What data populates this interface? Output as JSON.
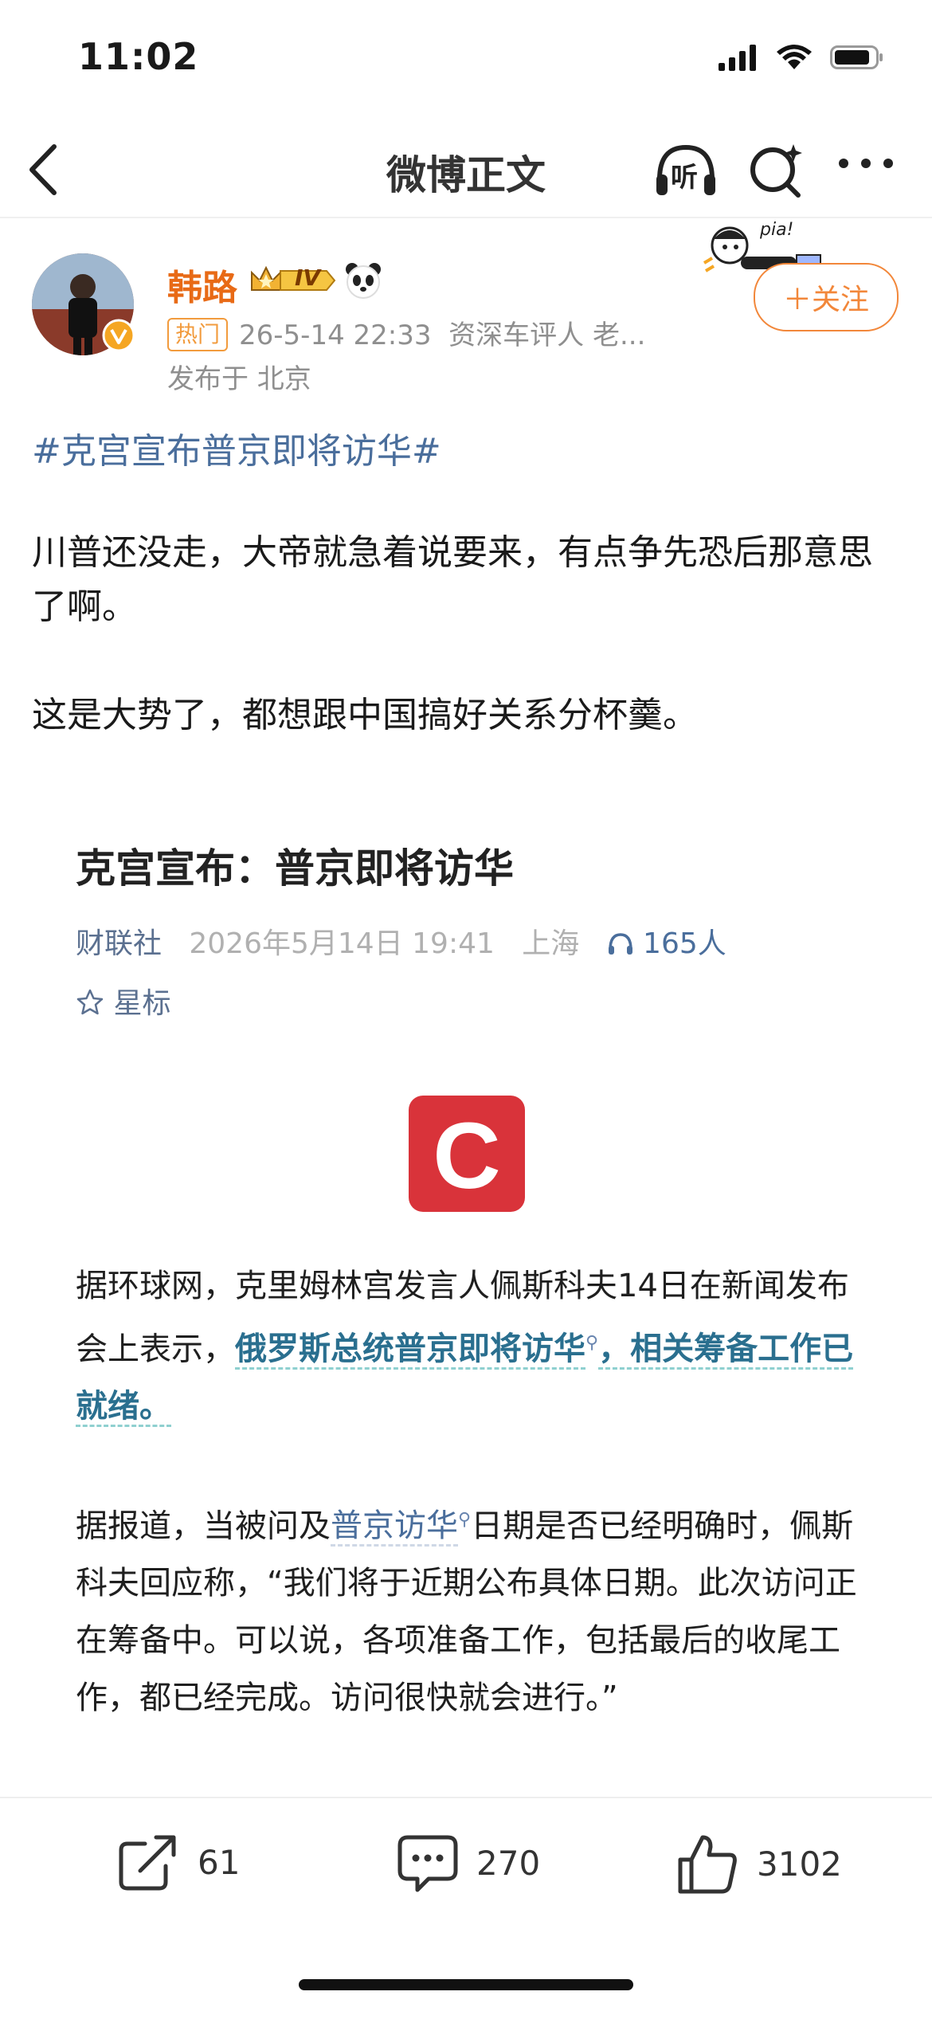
{
  "status_bar": {
    "time": "11:02"
  },
  "nav": {
    "title": "微博正文",
    "listen_label": "听"
  },
  "author": {
    "name": "韩路",
    "level_badge": "IV",
    "hot_badge": "热门",
    "timestamp": "26-5-14 22:33",
    "description": "资深车评人 老...",
    "location": "发布于 北京",
    "follow_label": "＋关注",
    "sticker_text": "pia!"
  },
  "post": {
    "hashtag": "#克宫宣布普京即将访华#",
    "paragraph1": "川普还没走，大帝就急着说要来，有点争先恐后那意思了啊。",
    "paragraph2": "这是大势了，都想跟中国搞好关系分杯羹。"
  },
  "article": {
    "title": "克宫宣布：普京即将访华",
    "source": "财联社",
    "datetime": "2026年5月14日 19:41",
    "place": "上海",
    "listeners": "165人",
    "star_label": "星标",
    "logo_letter": "C",
    "p1_start": "据环球网，克里姆林宫发言人佩斯科夫14日在新闻发布会上表示，",
    "p1_highlight": "俄罗斯总统普京即将访华",
    "p1_end": "，相关筹备工作已就绪。",
    "p2_start": "据报道，当被问及",
    "p2_link": "普京访华",
    "p2_end": "日期是否已经明确时，佩斯科夫回应称，“我们将于近期公布具体日期。此次访问正在筹备中。可以说，各项准备工作，包括最后的收尾工作，都已经完成。访问很快就会进行。”"
  },
  "actions": {
    "repost_count": "61",
    "comment_count": "270",
    "like_count": "3102"
  },
  "colors": {
    "accent_orange": "#f2873a",
    "link_blue": "#4a6e9c",
    "logo_red": "#d9333a"
  }
}
